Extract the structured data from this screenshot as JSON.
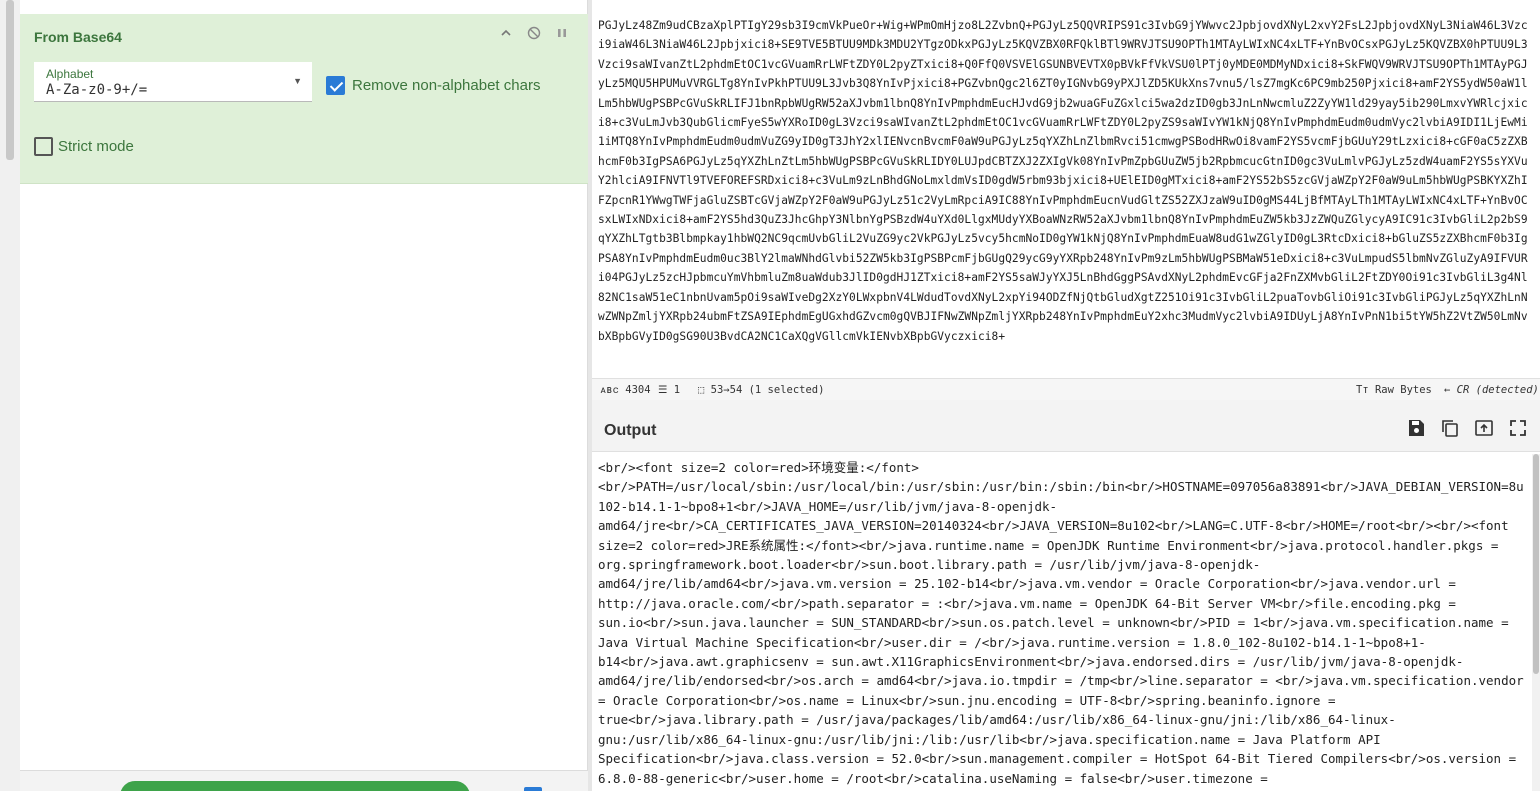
{
  "recipe": {
    "operation": {
      "title": "From Base64",
      "alphabet_label": "Alphabet",
      "alphabet_value": "A-Za-z0-9+/=",
      "remove_non_alphabet_label": "Remove non-alphabet chars",
      "remove_non_alphabet_checked": true,
      "strict_mode_label": "Strict mode",
      "strict_mode_checked": false
    }
  },
  "input": {
    "text": "PGJyLz48Zm9udCBzaXplPTIgY29sb3I9cmVkPueOr+Wig+WPmOmHjzo8L2ZvbnQ+PGJyLz5QQVRIPS91c3IvbG9jYWwvc2JpbjovdXNyL2xvY2FsL2JpbjovdXNyL3NiaW46L3Vzci9iaW46L3NiaW46L2Jpbjxici8+SE9TVE5BTUU9MDk3MDU2YTgzODkxPGJyLz5KQVZBX0RFQklBTl9WRVJTSU9OPTh1MTAyLWIxNC4xLTF+YnBvOCsxPGJyLz5KQVZBX0hPTUU9L3Vzci9saWIvanZtL2phdmEtOC1vcGVuamRrLWFtZDY0L2pyZTxici8+Q0FfQ0VSVElGSUNBVEVTX0pBVkFfVkVSU0lPTj0yMDE0MDMyNDxici8+SkFWQV9WRVJTSU9OPTh1MTAyPGJyLz5MQU5HPUMuVVRGLTg8YnIvPkhPTUU9L3Jvb3Q8YnIvPjxici8+PGZvbnQgc2l6ZT0yIGNvbG9yPXJlZD5KUkXns7vnu5/lsZ7mgKc6PC9mb250Pjxici8+amF2YS5ydW50aW1lLm5hbWUgPSBPcGVuSkRLIFJ1bnRpbWUgRW52aXJvbm1lbnQ8YnIvPmphdmEucHJvdG9jb2wuaGFuZGxlci5wa2dzID0gb3JnLnNwcmluZ2ZyYW1ld29yay5ib290LmxvYWRlcjxici8+c3VuLmJvb3QubGlicmFyeS5wYXRoID0gL3Vzci9saWIvanZtL2phdmEtOC1vcGVuamRrLWFtZDY0L2pyZS9saWIvYW1kNjQ8YnIvPmphdmEudm0udmVyc2lvbiA9IDI1LjEwMi1iMTQ8YnIvPmphdmEudm0udmVuZG9yID0gT3JhY2xlIENvcnBvcmF0aW9uPGJyLz5qYXZhLnZlbmRvci51cmwgPSBodHRwOi8vamF2YS5vcmFjbGUuY29tLzxici8+cGF0aC5zZXBhcmF0b3IgPSA6PGJyLz5qYXZhLnZtLm5hbWUgPSBPcGVuSkRLIDY0LUJpdCBTZXJ2ZXIgVk08YnIvPmZpbGUuZW5jb2RpbmcucGtnID0gc3VuLmlvPGJyLz5zdW4uamF2YS5sYXVuY2hlciA9IFNVTl9TVEFOREFSRDxici8+c3VuLm9zLnBhdGNoLmxldmVsID0gdW5rbm93bjxici8+UElEID0gMTxici8+amF2YS52bS5zcGVjaWZpY2F0aW9uLm5hbWUgPSBKYXZhIFZpcnR1YWwgTWFjaGluZSBTcGVjaWZpY2F0aW9uPGJyLz51c2VyLmRpciA9IC88YnIvPmphdmEucnVudGltZS52ZXJzaW9uID0gMS44LjBfMTAyLTh1MTAyLWIxNC4xLTF+YnBvOCsxLWIxNDxici8+amF2YS5hd3QuZ3JhcGhpY3NlbnYgPSBzdW4uYXd0LlgxMUdyYXBoaWNzRW52aXJvbm1lbnQ8YnIvPmphdmEuZW5kb3JzZWQuZGlycyA9IC91c3IvbGliL2p2bS9qYXZhLTgtb3Blbmpkay1hbWQ2NC9qcmUvbGliL2VuZG9yc2VkPGJyLz5vcy5hcmNoID0gYW1kNjQ8YnIvPmphdmEuaW8udG1wZGlyID0gL3RtcDxici8+bGluZS5zZXBhcmF0b3IgPSA8YnIvPmphdmEudm0uc3BlY2lmaWNhdGlvbi52ZW5kb3IgPSBPcmFjbGUgQ29ycG9yYXRpb248YnIvPm9zLm5hbWUgPSBMaW51eDxici8+c3VuLmpudS5lbmNvZGluZyA9IFVURi04PGJyLz5zcHJpbmcuYmVhbmluZm8uaWdub3JlID0gdHJ1ZTxici8+amF2YS5saWJyYXJ5LnBhdGggPSAvdXNyL2phdmEvcGFja2FnZXMvbGliL2FtZDY0Oi91c3IvbGliL3g4Nl82NC1saW51eC1nbnUvam5pOi9saWIveDg2XzY0LWxpbnV4LWdudTovdXNyL2xpYi94ODZfNjQtbGludXgtZ251Oi91c3IvbGliL2puaTovbGliOi91c3IvbGliPGJyLz5qYXZhLnNwZWNpZmljYXRpb24ubmFtZSA9IEphdmEgUGxhdGZvcm0gQVBJIFNwZWNpZmljYXRpb248YnIvPmphdmEuY2xhc3MudmVyc2lvbiA9IDUyLjA8YnIvPnN1bi5tYW5hZ2VtZW50LmNvbXBpbGVyID0gSG90U3BvdCA2NC1CaXQgVGllcmVkIENvbXBpbGVyczxici8+",
    "status": {
      "length": "4304",
      "lines": "1",
      "selection": "53→54 (1 selected)",
      "raw_bytes": "Raw Bytes",
      "line_ending": "CR (detected)"
    }
  },
  "output": {
    "title": "Output",
    "text": "<br/><font size=2 color=red>环境变量:</font>\n<br/>PATH=/usr/local/sbin:/usr/local/bin:/usr/sbin:/usr/bin:/sbin:/bin<br/>HOSTNAME=097056a83891<br/>JAVA_DEBIAN_VERSION=8u102-b14.1-1~bpo8+1<br/>JAVA_HOME=/usr/lib/jvm/java-8-openjdk-amd64/jre<br/>CA_CERTIFICATES_JAVA_VERSION=20140324<br/>JAVA_VERSION=8u102<br/>LANG=C.UTF-8<br/>HOME=/root<br/><br/><font size=2 color=red>JRE系统属性:</font><br/>java.runtime.name = OpenJDK Runtime Environment<br/>java.protocol.handler.pkgs = org.springframework.boot.loader<br/>sun.boot.library.path = /usr/lib/jvm/java-8-openjdk-amd64/jre/lib/amd64<br/>java.vm.version = 25.102-b14<br/>java.vm.vendor = Oracle Corporation<br/>java.vendor.url = http://java.oracle.com/<br/>path.separator = :<br/>java.vm.name = OpenJDK 64-Bit Server VM<br/>file.encoding.pkg = sun.io<br/>sun.java.launcher = SUN_STANDARD<br/>sun.os.patch.level = unknown<br/>PID = 1<br/>java.vm.specification.name = Java Virtual Machine Specification<br/>user.dir = /<br/>java.runtime.version = 1.8.0_102-8u102-b14.1-1~bpo8+1-b14<br/>java.awt.graphicsenv = sun.awt.X11GraphicsEnvironment<br/>java.endorsed.dirs = /usr/lib/jvm/java-8-openjdk-amd64/jre/lib/endorsed<br/>os.arch = amd64<br/>java.io.tmpdir = /tmp<br/>line.separator = <br/>java.vm.specification.vendor = Oracle Corporation<br/>os.name = Linux<br/>sun.jnu.encoding = UTF-8<br/>spring.beaninfo.ignore = true<br/>java.library.path = /usr/java/packages/lib/amd64:/usr/lib/x86_64-linux-gnu/jni:/lib/x86_64-linux-gnu:/usr/lib/x86_64-linux-gnu:/usr/lib/jni:/lib:/usr/lib<br/>java.specification.name = Java Platform API Specification<br/>java.class.version = 52.0<br/>sun.management.compiler = HotSpot 64-Bit Tiered Compilers<br/>os.version = 6.8.0-88-generic<br/>user.home = /root<br/>catalina.useNaming = false<br/>user.timezone ="
  },
  "icons": {
    "move_up": "chevron-up-icon",
    "disable": "disable-icon",
    "pause": "pause-icon",
    "dropdown": "caret-down-icon",
    "save": "save-icon",
    "copy": "copy-icon",
    "replace_input": "replace-input-icon",
    "maximize": "maximize-icon"
  }
}
